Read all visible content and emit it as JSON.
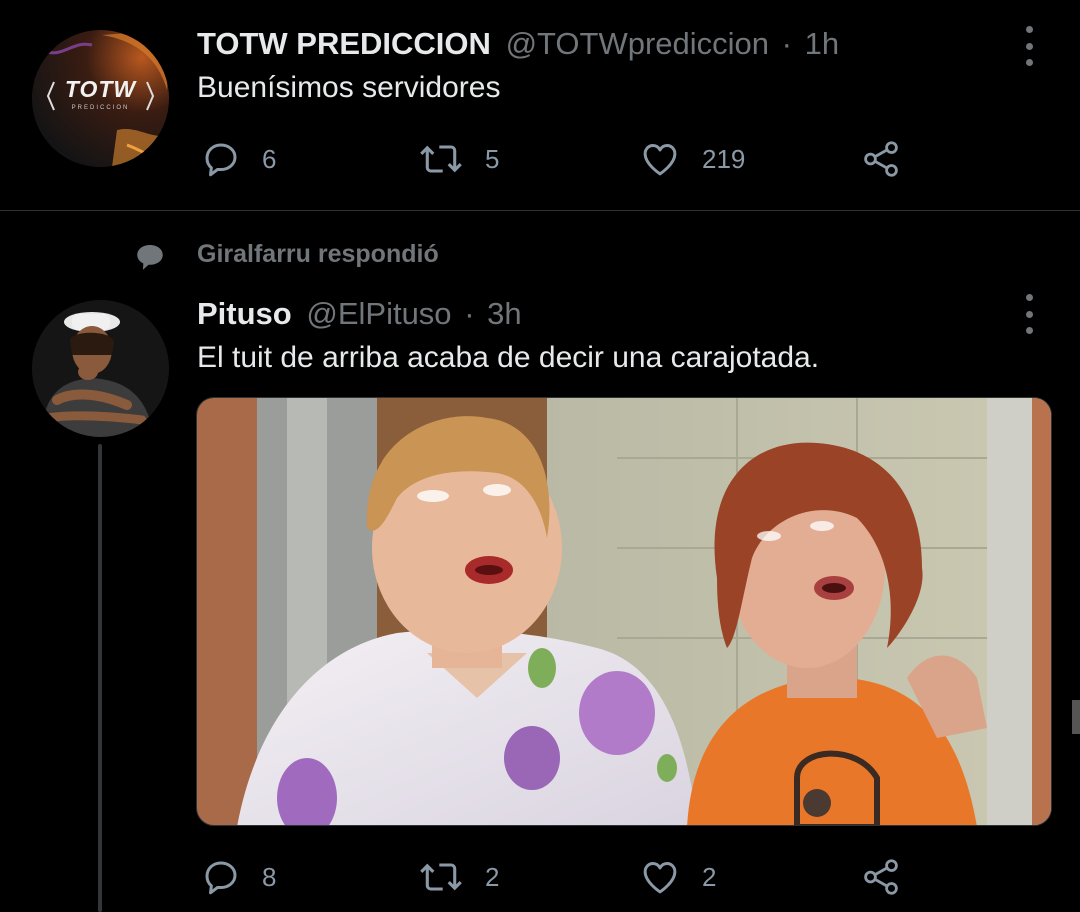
{
  "tweet1": {
    "avatar_text": "TOTW",
    "avatar_subtext": "PREDICCION",
    "display_name": "TOTW PREDICCION",
    "handle": "@TOTWprediccion",
    "separator": "·",
    "time": "1h",
    "text": "Buenísimos servidores",
    "replies": "6",
    "retweets": "5",
    "likes": "219"
  },
  "reply_context": {
    "text": "Giralfarru respondió",
    "icon": "speech-bubble-icon"
  },
  "tweet2": {
    "display_name": "Pituso",
    "handle": "@ElPituso",
    "separator": "·",
    "time": "3h",
    "text": "El tuit de arriba acaba de decir una carajotada.",
    "replies": "8",
    "retweets": "2",
    "likes": "2",
    "media": "photo of two women looking upward"
  },
  "colors": {
    "background": "#000000",
    "text_primary": "#e7e9ea",
    "text_muted": "#71767b",
    "icon": "#8b98a5",
    "divider": "#2f3336"
  }
}
